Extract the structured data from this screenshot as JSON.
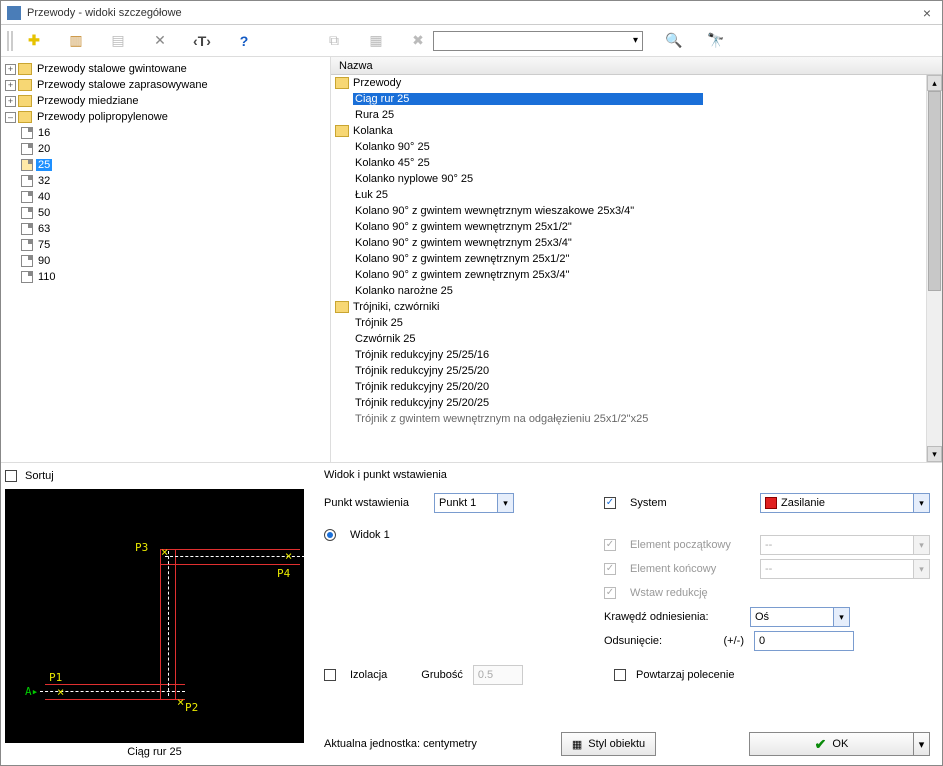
{
  "titlebar": {
    "text": "Przewody - widoki szczegółowe"
  },
  "toolbar": {
    "combo_value": ""
  },
  "tree": {
    "items": [
      {
        "label": "Przewody stalowe gwintowane"
      },
      {
        "label": "Przewody stalowe zaprasowywane"
      },
      {
        "label": "Przewody miedziane"
      },
      {
        "label": "Przewody polipropylenowe",
        "children": [
          "16",
          "20",
          "25",
          "32",
          "40",
          "50",
          "63",
          "75",
          "90",
          "110"
        ],
        "selected": "25"
      }
    ]
  },
  "list": {
    "header": "Nazwa",
    "groups": [
      {
        "name": "Przewody",
        "items": [
          "Ciąg rur 25",
          "Rura 25"
        ],
        "selected": "Ciąg rur 25"
      },
      {
        "name": "Kolanka",
        "items": [
          "Kolanko 90° 25",
          "Kolanko 45° 25",
          "Kolanko nyplowe 90° 25",
          "Łuk 25",
          "Kolano 90° z gwintem wewnętrznym wieszakowe 25x3/4\"",
          "Kolano 90° z gwintem wewnętrznym 25x1/2\"",
          "Kolano 90° z gwintem wewnętrznym 25x3/4\"",
          "Kolano 90° z gwintem zewnętrznym 25x1/2\"",
          "Kolano 90° z gwintem zewnętrznym 25x3/4\"",
          "Kolanko narożne 25"
        ]
      },
      {
        "name": "Trójniki, czwórniki",
        "items": [
          "Trójnik 25",
          "Czwórnik 25",
          "Trójnik redukcyjny 25/25/16",
          "Trójnik redukcyjny 25/25/20",
          "Trójnik redukcyjny 25/20/20",
          "Trójnik redukcyjny 25/20/25",
          "Trójnik z gwintem wewnętrznym na odgałęzieniu 25x1/2\"x25"
        ]
      }
    ]
  },
  "preview": {
    "sort_label": "Sortuj",
    "caption": "Ciąg rur 25",
    "points": [
      "P1",
      "P2",
      "P3",
      "P4"
    ]
  },
  "panel": {
    "section_title": "Widok i punkt wstawienia",
    "punkt_label": "Punkt wstawienia",
    "punkt_value": "Punkt 1",
    "widok1_label": "Widok 1",
    "system_label": "System",
    "system_value": "Zasilanie",
    "el_pocz_label": "Element początkowy",
    "el_pocz_value": "--",
    "el_konc_label": "Element końcowy",
    "el_konc_value": "--",
    "wstaw_label": "Wstaw redukcję",
    "krawedz_label": "Krawędź odniesienia:",
    "krawedz_value": "Oś",
    "odsun_label": "Odsunięcie:",
    "odsun_pm": "(+/-)",
    "odsun_value": "0",
    "izolacja_label": "Izolacja",
    "grubosc_label": "Grubość",
    "grubosc_value": "0.5",
    "powtarzaj_label": "Powtarzaj polecenie",
    "units_label": "Aktualna jednostka: centymetry",
    "style_btn": "Styl obiektu",
    "ok_btn": "OK"
  }
}
